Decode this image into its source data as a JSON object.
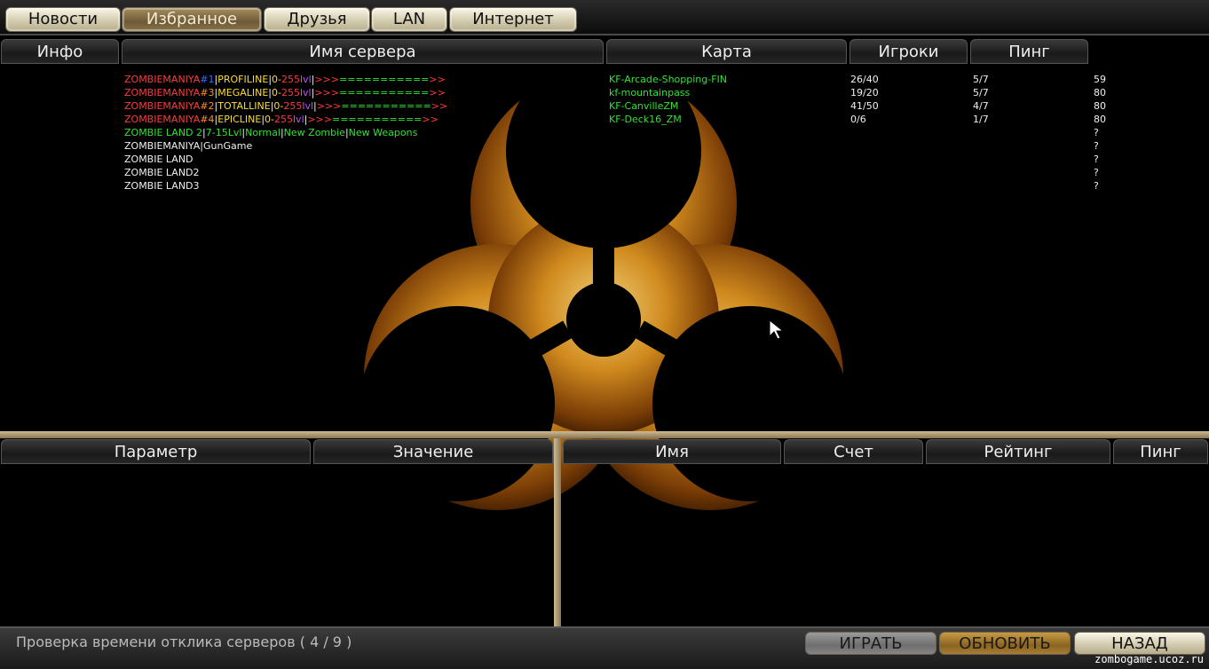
{
  "tabs": [
    {
      "label": "Новости",
      "active": false
    },
    {
      "label": "Избранное",
      "active": true
    },
    {
      "label": "Друзья",
      "active": false
    },
    {
      "label": "LAN",
      "active": false
    },
    {
      "label": "Интернет",
      "active": false
    }
  ],
  "server_table": {
    "columns": [
      "Инфо",
      "Имя сервера",
      "Карта",
      "Игроки",
      "Пинг"
    ],
    "rows": [
      {
        "name": [
          [
            "ZOMBIEMANIYA",
            "red"
          ],
          [
            "#1",
            "blue"
          ],
          [
            "|",
            "wht"
          ],
          [
            "PROFILINE",
            "yel"
          ],
          [
            "|",
            "wht"
          ],
          [
            "0-",
            "yel"
          ],
          [
            "255",
            "red"
          ],
          [
            "lvl",
            "pur"
          ],
          [
            "|",
            "wht"
          ],
          [
            ">>>",
            "red"
          ],
          [
            "===========",
            "grn"
          ],
          [
            ">>",
            "red"
          ]
        ],
        "map": "KF-Arcade-Shopping-FIN",
        "players": "26/40",
        "info": "5/7",
        "ping": "59"
      },
      {
        "name": [
          [
            "ZOMBIEMANIYA",
            "red"
          ],
          [
            "#3",
            "orn"
          ],
          [
            "|",
            "wht"
          ],
          [
            "MEGALINE",
            "yel"
          ],
          [
            "|",
            "wht"
          ],
          [
            "0-",
            "yel"
          ],
          [
            "255",
            "red"
          ],
          [
            "lvl",
            "pur"
          ],
          [
            "|",
            "wht"
          ],
          [
            ">>>",
            "red"
          ],
          [
            "===========",
            "grn"
          ],
          [
            ">>",
            "red"
          ]
        ],
        "map": "kf-mountainpass",
        "players": "19/20",
        "info": "5/7",
        "ping": "80"
      },
      {
        "name": [
          [
            "ZOMBIEMANIYA",
            "red"
          ],
          [
            "#2",
            "orn"
          ],
          [
            "|",
            "wht"
          ],
          [
            "TOTALLINE",
            "yel"
          ],
          [
            "|",
            "wht"
          ],
          [
            "0-",
            "yel"
          ],
          [
            "255",
            "red"
          ],
          [
            "lvl",
            "pur"
          ],
          [
            "|",
            "wht"
          ],
          [
            ">>>",
            "red"
          ],
          [
            "===========",
            "grn"
          ],
          [
            ">>",
            "red"
          ]
        ],
        "map": "KF-CanvilleZM",
        "players": "41/50",
        "info": "4/7",
        "ping": "80"
      },
      {
        "name": [
          [
            "ZOMBIEMANIYA",
            "red"
          ],
          [
            "#4",
            "orn"
          ],
          [
            "|",
            "wht"
          ],
          [
            "EPICLINE",
            "yel"
          ],
          [
            "|",
            "wht"
          ],
          [
            "0-",
            "yel"
          ],
          [
            "255",
            "red"
          ],
          [
            "lvl",
            "pur"
          ],
          [
            "|",
            "wht"
          ],
          [
            ">>>",
            "red"
          ],
          [
            "===========",
            "grn"
          ],
          [
            ">>",
            "red"
          ]
        ],
        "map": "KF-Deck16_ZM",
        "players": "0/6",
        "info": "1/7",
        "ping": "80"
      },
      {
        "name": [
          [
            "ZOMBIE  LAND 2",
            "grn"
          ],
          [
            "|",
            "wht"
          ],
          [
            "7-15Lvl",
            "grn"
          ],
          [
            "|",
            "wht"
          ],
          [
            "Normal",
            "grn"
          ],
          [
            "|",
            "wht"
          ],
          [
            "New Zombie",
            "grn"
          ],
          [
            "|",
            "wht"
          ],
          [
            "New  Weapons",
            "grn"
          ]
        ],
        "map": "",
        "players": "",
        "info": "",
        "ping": "?"
      },
      {
        "name": [
          [
            " ZOMBIEMANIYA|GunGame",
            "wht"
          ]
        ],
        "map": "",
        "players": "",
        "info": "",
        "ping": "?"
      },
      {
        "name": [
          [
            " ZOMBIE LAND",
            "wht"
          ]
        ],
        "map": "",
        "players": "",
        "info": "",
        "ping": "?"
      },
      {
        "name": [
          [
            " ZOMBIE LAND2",
            "wht"
          ]
        ],
        "map": "",
        "players": "",
        "info": "",
        "ping": "?"
      },
      {
        "name": [
          [
            " ZOMBIE LAND3",
            "wht"
          ]
        ],
        "map": "",
        "players": "",
        "info": "",
        "ping": "?"
      }
    ]
  },
  "rules_table": {
    "columns": [
      "Параметр",
      "Значение"
    ]
  },
  "players_table": {
    "columns": [
      "Имя",
      "Счет",
      "Рейтинг",
      "Пинг"
    ]
  },
  "status_text": "Проверка времени отклика серверов ( 4 / 9 )",
  "buttons": {
    "play": "ИГРАТЬ",
    "refresh": "ОБНОВИТЬ",
    "back": "НАЗАД"
  },
  "watermark": "zombogame.ucoz.ru",
  "colors": {
    "red": "#ff3b3b",
    "blue": "#3b6bff",
    "yellow": "#ffdc2e",
    "green": "#35e035",
    "purple": "#c050ff",
    "orange": "#ff8c2a"
  }
}
